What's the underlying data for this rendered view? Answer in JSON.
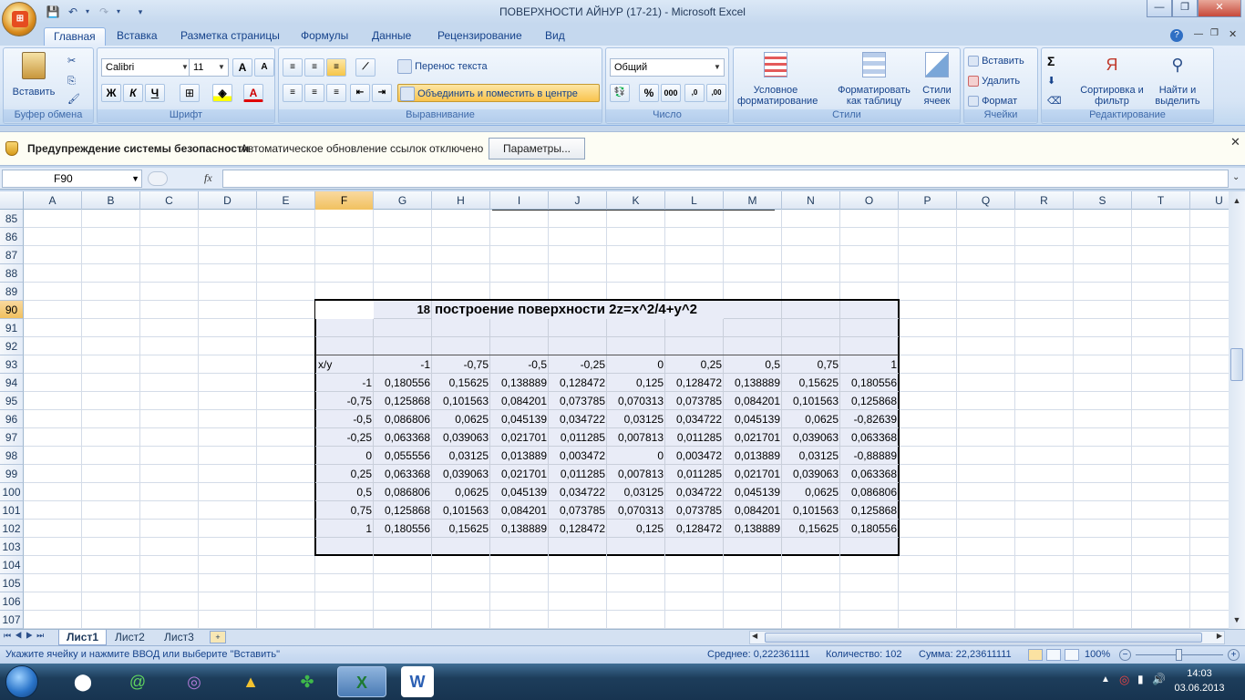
{
  "window": {
    "title": "ПОВЕРХНОСТИ АЙНУР (17-21) - Microsoft Excel",
    "minimize": "—",
    "maximize": "❐",
    "close": "✕"
  },
  "ribbon_tabs": [
    "Главная",
    "Вставка",
    "Разметка страницы",
    "Формулы",
    "Данные",
    "Рецензирование",
    "Вид"
  ],
  "ribbon": {
    "clipboard": {
      "label": "Буфер обмена",
      "paste": "Вставить"
    },
    "font": {
      "label": "Шрифт",
      "name": "Calibri",
      "size": "11",
      "bold": "Ж",
      "italic": "К",
      "underline": "Ч",
      "grow": "A",
      "shrink": "A"
    },
    "alignment": {
      "label": "Выравнивание",
      "wrap": "Перенос текста",
      "merge": "Объединить и поместить в центре"
    },
    "number": {
      "label": "Число",
      "format": "Общий",
      "percent": "%",
      "thousands": "000"
    },
    "styles": {
      "label": "Стили",
      "conditional": "Условное форматирование",
      "as_table": "Форматировать как таблицу",
      "cell_styles": "Стили ячеек"
    },
    "cells": {
      "label": "Ячейки",
      "insert": "Вставить",
      "delete": "Удалить",
      "format": "Формат"
    },
    "editing": {
      "label": "Редактирование",
      "sum": "Σ",
      "sort": "Сортировка и фильтр",
      "find": "Найти и выделить"
    }
  },
  "security": {
    "title": "Предупреждение системы безопасности",
    "message": "Автоматическое обновление ссылок отключено",
    "button": "Параметры..."
  },
  "formula_bar": {
    "name_box": "F90",
    "fx": "fx",
    "formula": ""
  },
  "columns": [
    "A",
    "B",
    "C",
    "D",
    "E",
    "F",
    "G",
    "H",
    "I",
    "J",
    "K",
    "L",
    "M",
    "N",
    "O",
    "P",
    "Q",
    "R",
    "S",
    "T",
    "U"
  ],
  "rows": [
    "85",
    "86",
    "87",
    "88",
    "89",
    "90",
    "91",
    "92",
    "93",
    "94",
    "95",
    "96",
    "97",
    "98",
    "99",
    "100",
    "101",
    "102",
    "103",
    "104",
    "105",
    "106",
    "107"
  ],
  "table": {
    "number_cell": "18",
    "heading": "построение поверхности 2z=x^2/4+y^2",
    "corner": "x/y",
    "x_values": [
      "-1",
      "-0,75",
      "-0,5",
      "-0,25",
      "0",
      "0,25",
      "0,5",
      "0,75",
      "1"
    ],
    "rows": [
      {
        "y": "-1",
        "values": [
          "0,180556",
          "0,15625",
          "0,138889",
          "0,128472",
          "0,125",
          "0,128472",
          "0,138889",
          "0,15625",
          "0,180556"
        ]
      },
      {
        "y": "-0,75",
        "values": [
          "0,125868",
          "0,101563",
          "0,084201",
          "0,073785",
          "0,070313",
          "0,073785",
          "0,084201",
          "0,101563",
          "0,125868"
        ]
      },
      {
        "y": "-0,5",
        "values": [
          "0,086806",
          "0,0625",
          "0,045139",
          "0,034722",
          "0,03125",
          "0,034722",
          "0,045139",
          "0,0625",
          "-0,82639"
        ]
      },
      {
        "y": "-0,25",
        "values": [
          "0,063368",
          "0,039063",
          "0,021701",
          "0,011285",
          "0,007813",
          "0,011285",
          "0,021701",
          "0,039063",
          "0,063368"
        ]
      },
      {
        "y": "0",
        "values": [
          "0,055556",
          "0,03125",
          "0,013889",
          "0,003472",
          "0",
          "0,003472",
          "0,013889",
          "0,03125",
          "-0,88889"
        ]
      },
      {
        "y": "0,25",
        "values": [
          "0,063368",
          "0,039063",
          "0,021701",
          "0,011285",
          "0,007813",
          "0,011285",
          "0,021701",
          "0,039063",
          "0,063368"
        ]
      },
      {
        "y": "0,5",
        "values": [
          "0,086806",
          "0,0625",
          "0,045139",
          "0,034722",
          "0,03125",
          "0,034722",
          "0,045139",
          "0,0625",
          "0,086806"
        ]
      },
      {
        "y": "0,75",
        "values": [
          "0,125868",
          "0,101563",
          "0,084201",
          "0,073785",
          "0,070313",
          "0,073785",
          "0,084201",
          "0,101563",
          "0,125868"
        ]
      },
      {
        "y": "1",
        "values": [
          "0,180556",
          "0,15625",
          "0,138889",
          "0,128472",
          "0,125",
          "0,128472",
          "0,138889",
          "0,15625",
          "0,180556"
        ]
      }
    ]
  },
  "sheets": [
    "Лист1",
    "Лист2",
    "Лист3"
  ],
  "status": {
    "message": "Укажите ячейку и нажмите ВВОД или выберите \"Вставить\"",
    "average": "Среднее: 0,222361111",
    "count": "Количество: 102",
    "sum": "Сумма: 22,23611111",
    "zoom": "100%"
  },
  "clock": {
    "time": "14:03",
    "date": "03.06.2013"
  },
  "colors": {
    "selected_header": "#f1c15f",
    "table_fill": "#e9ecf7",
    "ribbon_bg": "#dde9f7"
  }
}
